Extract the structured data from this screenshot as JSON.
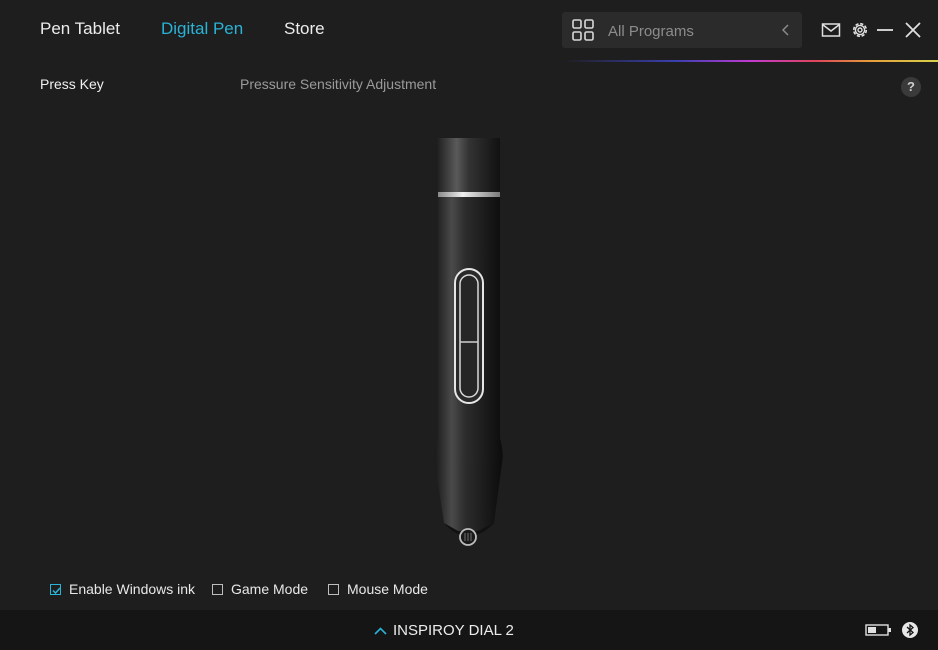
{
  "tabs": [
    {
      "label": "Pen Tablet",
      "active": false
    },
    {
      "label": "Digital Pen",
      "active": true
    },
    {
      "label": "Store",
      "active": false
    }
  ],
  "search": {
    "placeholder": "All Programs",
    "icon": "grid-icon"
  },
  "window_controls": [
    "mail-icon",
    "gear-icon",
    "minimize-icon",
    "close-icon"
  ],
  "subtabs": [
    {
      "label": "Press Key",
      "active": true
    },
    {
      "label": "Pressure Sensitivity Adjustment",
      "active": false
    }
  ],
  "help": {
    "label": "?"
  },
  "options": [
    {
      "label": "Enable Windows ink",
      "checked": true
    },
    {
      "label": "Game Mode",
      "checked": false
    },
    {
      "label": "Mouse Mode",
      "checked": false
    }
  ],
  "device": {
    "name": "INSPIROY DIAL 2"
  },
  "colors": {
    "accent": "#29b3d6",
    "background": "#1e1e1e",
    "bottom_bar": "#151515"
  }
}
